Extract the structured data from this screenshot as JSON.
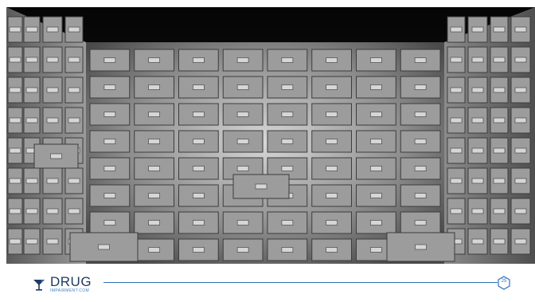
{
  "photo": {
    "description_icon": "filing-cabinet-room-photo"
  },
  "logo": {
    "word": "DRUG",
    "subtitle": "IMPAIRMENT.COM"
  },
  "page_number": "25",
  "colors": {
    "brand_dark": "#1d3a5f",
    "brand_blue": "#2f73b8",
    "cabinet_gray": "#8a8a8a"
  }
}
